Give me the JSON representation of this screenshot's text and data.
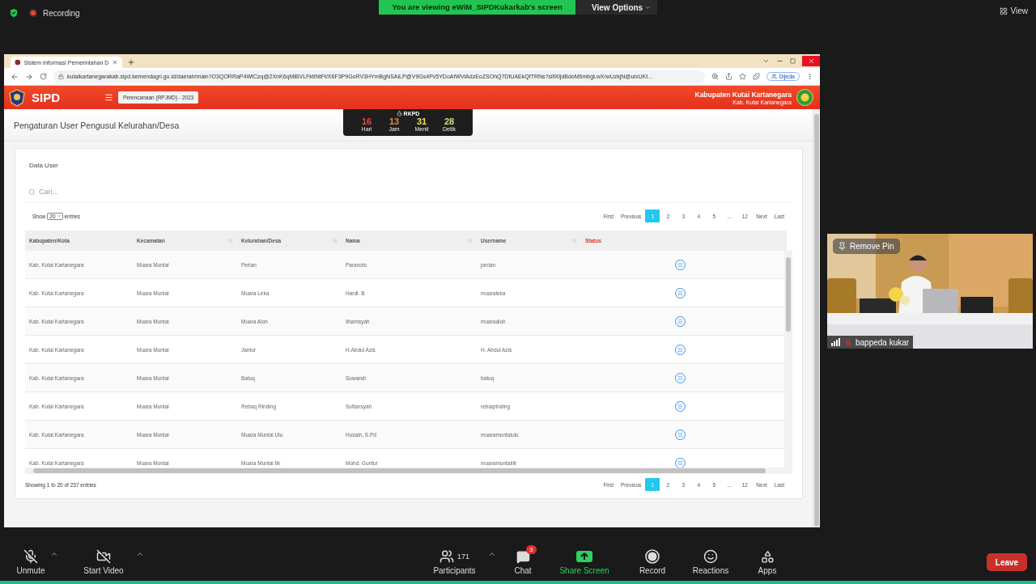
{
  "meeting": {
    "recording": "Recording",
    "banner": "You are viewing eWiM_SIPDKukarkab's screen",
    "view_options": "View Options",
    "view": "View"
  },
  "browser": {
    "tab_title": "Sistem Informasi Pemerintahan D",
    "url": "kutaikartanegarakab.sipd.kemendagri.go.id/daerah/main?O3QORRaP4WtCzq@2XnK6qMiBVLFktINtFt/X6F3P9GoRV3HYmBgNSAiLP@V9Gs4Pv5YDoAfWViAdzEoZSOhQ7DfUAEkQfTRNs?sil90jdBdoM6mbgLwX/wUzkjN@ulxUKt...",
    "profile": "Dijeda"
  },
  "header": {
    "brand": "SIPD",
    "period": "Perencanaan (RPJMD) - 2023",
    "region": "Kabupaten Kutai Kartanegara",
    "subregion": "Kab. Kutai Kartanegara"
  },
  "countdown": {
    "title": "RKPD",
    "units": [
      {
        "value": "16",
        "label": "Hari",
        "color": "#e8453c"
      },
      {
        "value": "13",
        "label": "Jam",
        "color": "#e8893c"
      },
      {
        "value": "31",
        "label": "Menit",
        "color": "#f0e050"
      },
      {
        "value": "28",
        "label": "Detik",
        "color": "#c9e07a"
      }
    ]
  },
  "page_title": "Pengaturan User Pengusul Kelurahan/Desa",
  "card": {
    "title": "Data User",
    "search": {
      "placeholder": "Cari..."
    },
    "length": {
      "show": "Show",
      "value": "20",
      "entries": "entries"
    },
    "pagination_top": [
      {
        "label": "First",
        "selected": false
      },
      {
        "label": "Previous",
        "selected": false
      },
      {
        "label": "1",
        "selected": true
      },
      {
        "label": "2",
        "selected": false
      },
      {
        "label": "3",
        "selected": false
      },
      {
        "label": "4",
        "selected": false
      },
      {
        "label": "5",
        "selected": false
      },
      {
        "label": "...",
        "selected": false
      },
      {
        "label": "12",
        "selected": false
      },
      {
        "label": "Next",
        "selected": false
      },
      {
        "label": "Last",
        "selected": false
      }
    ],
    "columns": [
      {
        "label": "Kabupaten/Kota",
        "sortable": false,
        "highlighted": false
      },
      {
        "label": "Kecamatan",
        "sortable": true,
        "highlighted": false
      },
      {
        "label": "Kelurahan/Desa",
        "sortable": true,
        "highlighted": false
      },
      {
        "label": "Nama",
        "sortable": true,
        "highlighted": false
      },
      {
        "label": "Username",
        "sortable": true,
        "highlighted": false
      },
      {
        "label": "Status",
        "sortable": false,
        "highlighted": true
      }
    ],
    "rows": [
      [
        "Kab. Kutai Kartanegara",
        "Muara Muntai",
        "Perian",
        "Paranoto",
        "perian"
      ],
      [
        "Kab. Kutai Kartanegara",
        "Muara Muntai",
        "Muara Leka",
        "Hardi. B",
        "muaraleka"
      ],
      [
        "Kab. Kutai Kartanegara",
        "Muara Muntai",
        "Muara Aloh",
        "Ilhamsyah",
        "muaraaloh"
      ],
      [
        "Kab. Kutai Kartanegara",
        "Muara Muntai",
        "Jantur",
        "H.Abdul Azis",
        "H. Abdul Azis"
      ],
      [
        "Kab. Kutai Kartanegara",
        "Muara Muntai",
        "Batuq",
        "Suwandi",
        "batuq"
      ],
      [
        "Kab. Kutai Kartanegara",
        "Muara Muntai",
        "Rebaq Rinding",
        "Sofiansyah",
        "rebaqrinding"
      ],
      [
        "Kab. Kutai Kartanegara",
        "Muara Muntai",
        "Muara Muntai Ulu",
        "Husain, S.Pd",
        "muaramuntaiulu"
      ],
      [
        "Kab. Kutai Kartanegara",
        "Muara Muntai",
        "Muara Muntai Ilir",
        "Mohd. Guntur",
        "muaramuntaiilir"
      ]
    ],
    "info": "Showing 1 to 20 of 237 entries",
    "pagination_bottom": [
      {
        "label": "First",
        "selected": false
      },
      {
        "label": "Previous",
        "selected": false
      },
      {
        "label": "1",
        "selected": true
      },
      {
        "label": "2",
        "selected": false
      },
      {
        "label": "3",
        "selected": false
      },
      {
        "label": "4",
        "selected": false
      },
      {
        "label": "5",
        "selected": false
      },
      {
        "label": "...",
        "selected": false
      },
      {
        "label": "12",
        "selected": false
      },
      {
        "label": "Next",
        "selected": false
      },
      {
        "label": "Last",
        "selected": false
      }
    ]
  },
  "video": {
    "remove_pin": "Remove Pin",
    "name": "bappeda kukar",
    "muted": true,
    "kind": "picture"
  },
  "toolbar": {
    "items": [
      {
        "kind": "mic",
        "label": "Unmute",
        "off": true
      },
      {
        "kind": "camera",
        "label": "Start Video",
        "off": true
      },
      {
        "kind": "participants",
        "label": "Participants",
        "count": "171"
      },
      {
        "kind": "chat",
        "label": "Chat",
        "badge": "3"
      },
      {
        "kind": "share",
        "label": "Share Screen"
      },
      {
        "kind": "record",
        "label": "Record"
      },
      {
        "kind": "reactions",
        "label": "Reactions"
      },
      {
        "kind": "apps",
        "label": "Apps"
      }
    ],
    "leave": "Leave"
  }
}
